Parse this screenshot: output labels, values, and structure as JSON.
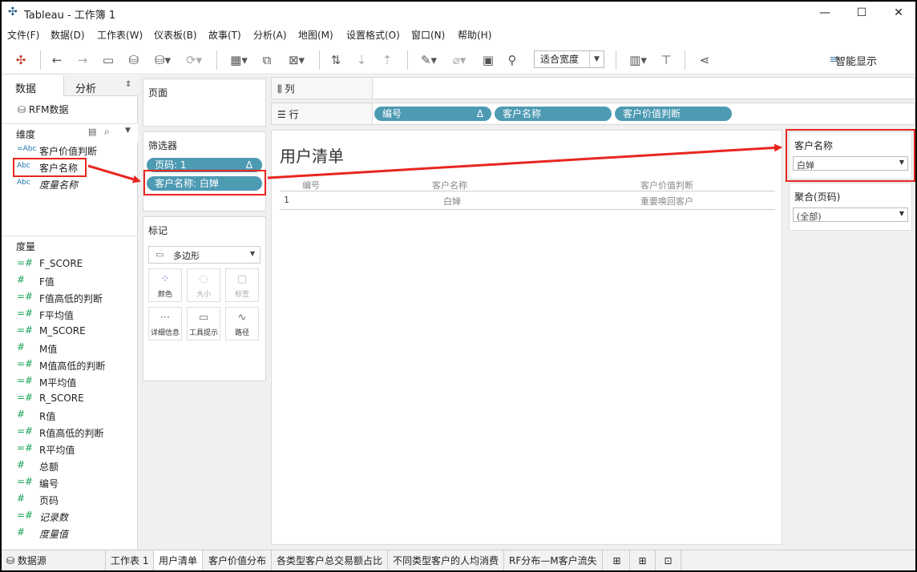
{
  "window": {
    "title": "Tableau - 工作簿 1"
  },
  "menu": [
    "文件(F)",
    "数据(D)",
    "工作表(W)",
    "仪表板(B)",
    "故事(T)",
    "分析(A)",
    "地图(M)",
    "设置格式(O)",
    "窗口(N)",
    "帮助(H)"
  ],
  "toolbar": {
    "fit_select": "适合宽度",
    "smart_display": "智能显示"
  },
  "left_pane": {
    "tab_data": "数据",
    "tab_analysis": "分析",
    "datasource": "RFM数据",
    "dimensions_header": "维度",
    "dimensions": [
      {
        "type": "=Abc",
        "label": "客户价值判断",
        "italic": false
      },
      {
        "type": "Abc",
        "label": "客户名称",
        "italic": false
      },
      {
        "type": "Abc",
        "label": "度量名称",
        "italic": true
      }
    ],
    "measures_header": "度量",
    "measures": [
      {
        "type": "=#",
        "label": "F_SCORE",
        "italic": false
      },
      {
        "type": "#",
        "label": "F值",
        "italic": false
      },
      {
        "type": "=#",
        "label": "F值高低的判断",
        "italic": false
      },
      {
        "type": "=#",
        "label": "F平均值",
        "italic": false
      },
      {
        "type": "=#",
        "label": "M_SCORE",
        "italic": false
      },
      {
        "type": "#",
        "label": "M值",
        "italic": false
      },
      {
        "type": "=#",
        "label": "M值高低的判断",
        "italic": false
      },
      {
        "type": "=#",
        "label": "M平均值",
        "italic": false
      },
      {
        "type": "=#",
        "label": "R_SCORE",
        "italic": false
      },
      {
        "type": "#",
        "label": "R值",
        "italic": false
      },
      {
        "type": "=#",
        "label": "R值高低的判断",
        "italic": false
      },
      {
        "type": "=#",
        "label": "R平均值",
        "italic": false
      },
      {
        "type": "#",
        "label": "总额",
        "italic": false
      },
      {
        "type": "=#",
        "label": "编号",
        "italic": false
      },
      {
        "type": "#",
        "label": "页码",
        "italic": false
      },
      {
        "type": "=#",
        "label": "记录数",
        "italic": true
      },
      {
        "type": "#",
        "label": "度量值",
        "italic": true
      }
    ]
  },
  "cards": {
    "pages": "页面",
    "filters": "筛选器",
    "filter_pills": [
      "页码: 1",
      "客户名称: 白婵"
    ],
    "filter_pill_delta": "Δ",
    "marks": "标记",
    "marks_type": "多边形",
    "mark_buttons": [
      "颜色",
      "大小",
      "标签",
      "详细信息",
      "工具提示",
      "路径"
    ]
  },
  "shelves": {
    "columns_label": "列",
    "rows_label": "行",
    "row_pills": [
      "编号",
      "客户名称",
      "客户价值判断"
    ],
    "row_pill_delta": "Δ"
  },
  "view": {
    "title": "用户清单",
    "headers": [
      "编号",
      "客户名称",
      "客户价值判断"
    ],
    "rows": [
      [
        "1",
        "白婵",
        "重要唤回客户"
      ]
    ]
  },
  "quick_filters": [
    {
      "title": "客户名称",
      "value": "白婵"
    },
    {
      "title": "聚合(页码)",
      "value": "(全部)"
    }
  ],
  "sheet_tabs": {
    "datasource": "数据源",
    "sheets": [
      "工作表 1",
      "用户清单",
      "客户价值分布",
      "各类型客户总交易额占比",
      "不同类型客户的人均消费",
      "RF分布—M客户流失"
    ],
    "active": "用户清单"
  },
  "colors": {
    "pill": "#4d9ab3",
    "highlight": "#e8261f",
    "dimension_icon": "#1f77b4",
    "measure_icon": "#1aa35a"
  }
}
